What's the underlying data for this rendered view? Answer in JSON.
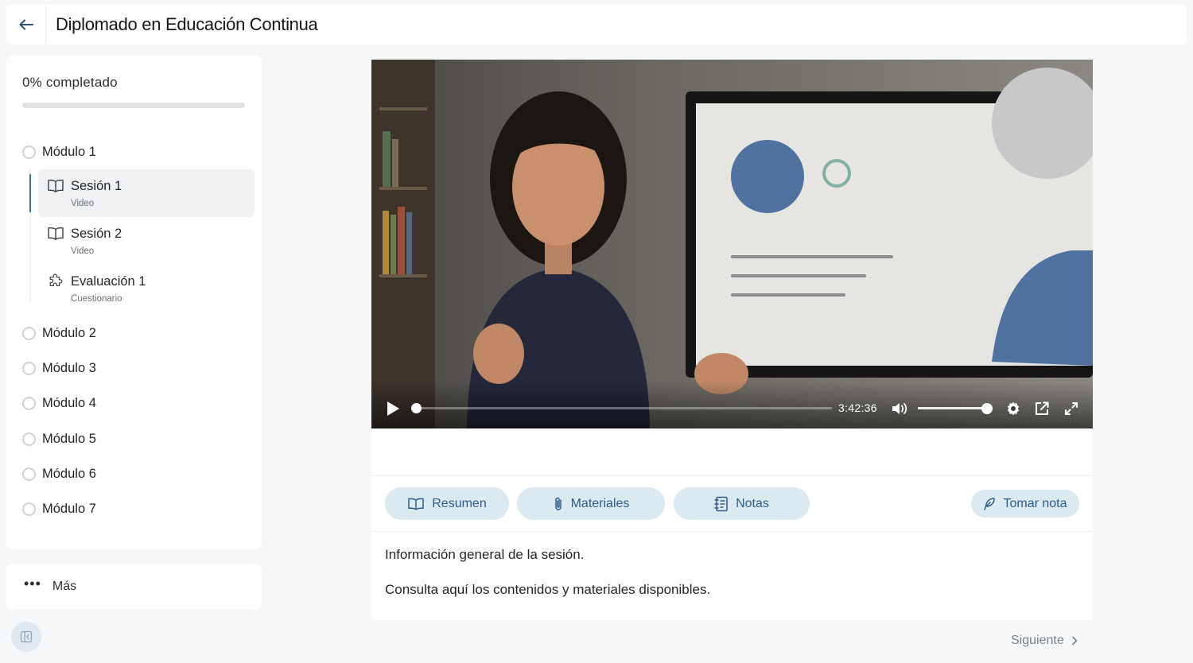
{
  "header": {
    "title": "Diplomado en Educación Continua",
    "back_icon": "arrow-left-icon"
  },
  "sidebar": {
    "progress_label": "0% completado",
    "progress_value": 0,
    "modules": [
      {
        "label": "Módulo 1"
      },
      {
        "label": "Módulo 2"
      },
      {
        "label": "Módulo 3"
      },
      {
        "label": "Módulo 4"
      },
      {
        "label": "Módulo 5"
      },
      {
        "label": "Módulo 6"
      },
      {
        "label": "Módulo 7"
      }
    ],
    "sessions": [
      {
        "title": "Sesión 1",
        "type": "Video",
        "icon": "book-icon",
        "active": true
      },
      {
        "title": "Sesión 2",
        "type": "Video",
        "icon": "book-icon",
        "active": false
      },
      {
        "title": "Evaluación 1",
        "type": "Cuestionario",
        "icon": "puzzle-icon",
        "active": false
      }
    ],
    "more_label": "Más"
  },
  "player": {
    "time": "3:42:36",
    "progress": 0,
    "volume": 0.92
  },
  "tabs": [
    {
      "label": "Resumen",
      "icon": "book-icon"
    },
    {
      "label": "Materiales",
      "icon": "paperclip-icon"
    },
    {
      "label": "Notas",
      "icon": "notebook-icon"
    }
  ],
  "take_note_label": "Tomar nota",
  "content": {
    "line1": "Información general de la sesión.",
    "line2": "Consulta aquí los contenidos y materiales disponibles."
  },
  "next_label": "Siguiente",
  "colors": {
    "accent": "#3f6ea8",
    "tab_bg": "#dbe9f1",
    "tab_text": "#2c5c8d"
  }
}
